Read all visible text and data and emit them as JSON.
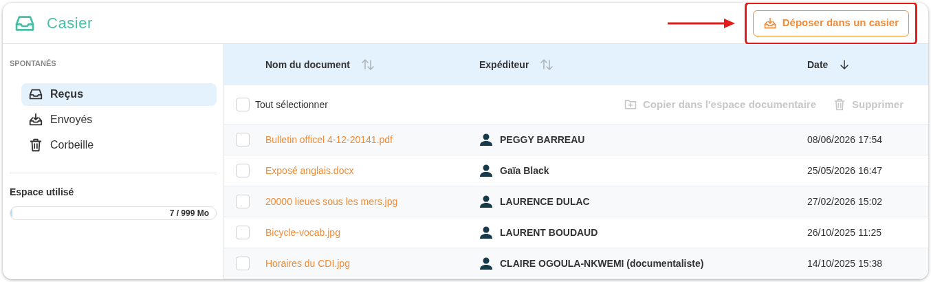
{
  "header": {
    "title": "Casier",
    "deposit_button": "Déposer dans un casier",
    "highlighted": true
  },
  "sidebar": {
    "section": "SPONTANÉS",
    "items": [
      {
        "label": "Reçus",
        "kind": "inbox",
        "selected": true
      },
      {
        "label": "Envoyés",
        "kind": "sent",
        "selected": false
      },
      {
        "label": "Corbeille",
        "kind": "trash",
        "selected": false
      }
    ],
    "storage": {
      "title": "Espace utilisé",
      "level": 0.01,
      "reading": "7 / 999 Mo"
    }
  },
  "table": {
    "columns": [
      {
        "label": "Nom du document",
        "sorted": false
      },
      {
        "label": "Expéditeur",
        "sorted": false
      },
      {
        "label": "Date",
        "sorted": true
      }
    ],
    "select_all": {
      "label": "Tout sélectionner",
      "checked": false
    },
    "actions": [
      {
        "label": "Copier dans l'espace documentaire",
        "kind": "copy",
        "disabled": true
      },
      {
        "label": "Supprimer",
        "kind": "delete",
        "disabled": true
      }
    ],
    "rows": [
      {
        "name": "Bulletin officel 4-12-20141.pdf",
        "sender": "PEGGY BARREAU",
        "date": "08/06/2026 17:54",
        "checked": false
      },
      {
        "name": "Exposé anglais.docx",
        "sender": "Gaïa Black",
        "date": "25/05/2026 16:47",
        "checked": false
      },
      {
        "name": "20000 lieues sous les mers.jpg",
        "sender": "LAURENCE DULAC",
        "date": "27/02/2026 15:02",
        "checked": false
      },
      {
        "name": "Bicycle-vocab.jpg",
        "sender": "LAURENT BOUDAUD",
        "date": "26/10/2025 11:25",
        "checked": false
      },
      {
        "name": "Horaires du CDI.jpg",
        "sender": "CLAIRE OGOULA-NKWEMI (documentaliste)",
        "date": "14/10/2025 15:38",
        "checked": false
      }
    ]
  }
}
